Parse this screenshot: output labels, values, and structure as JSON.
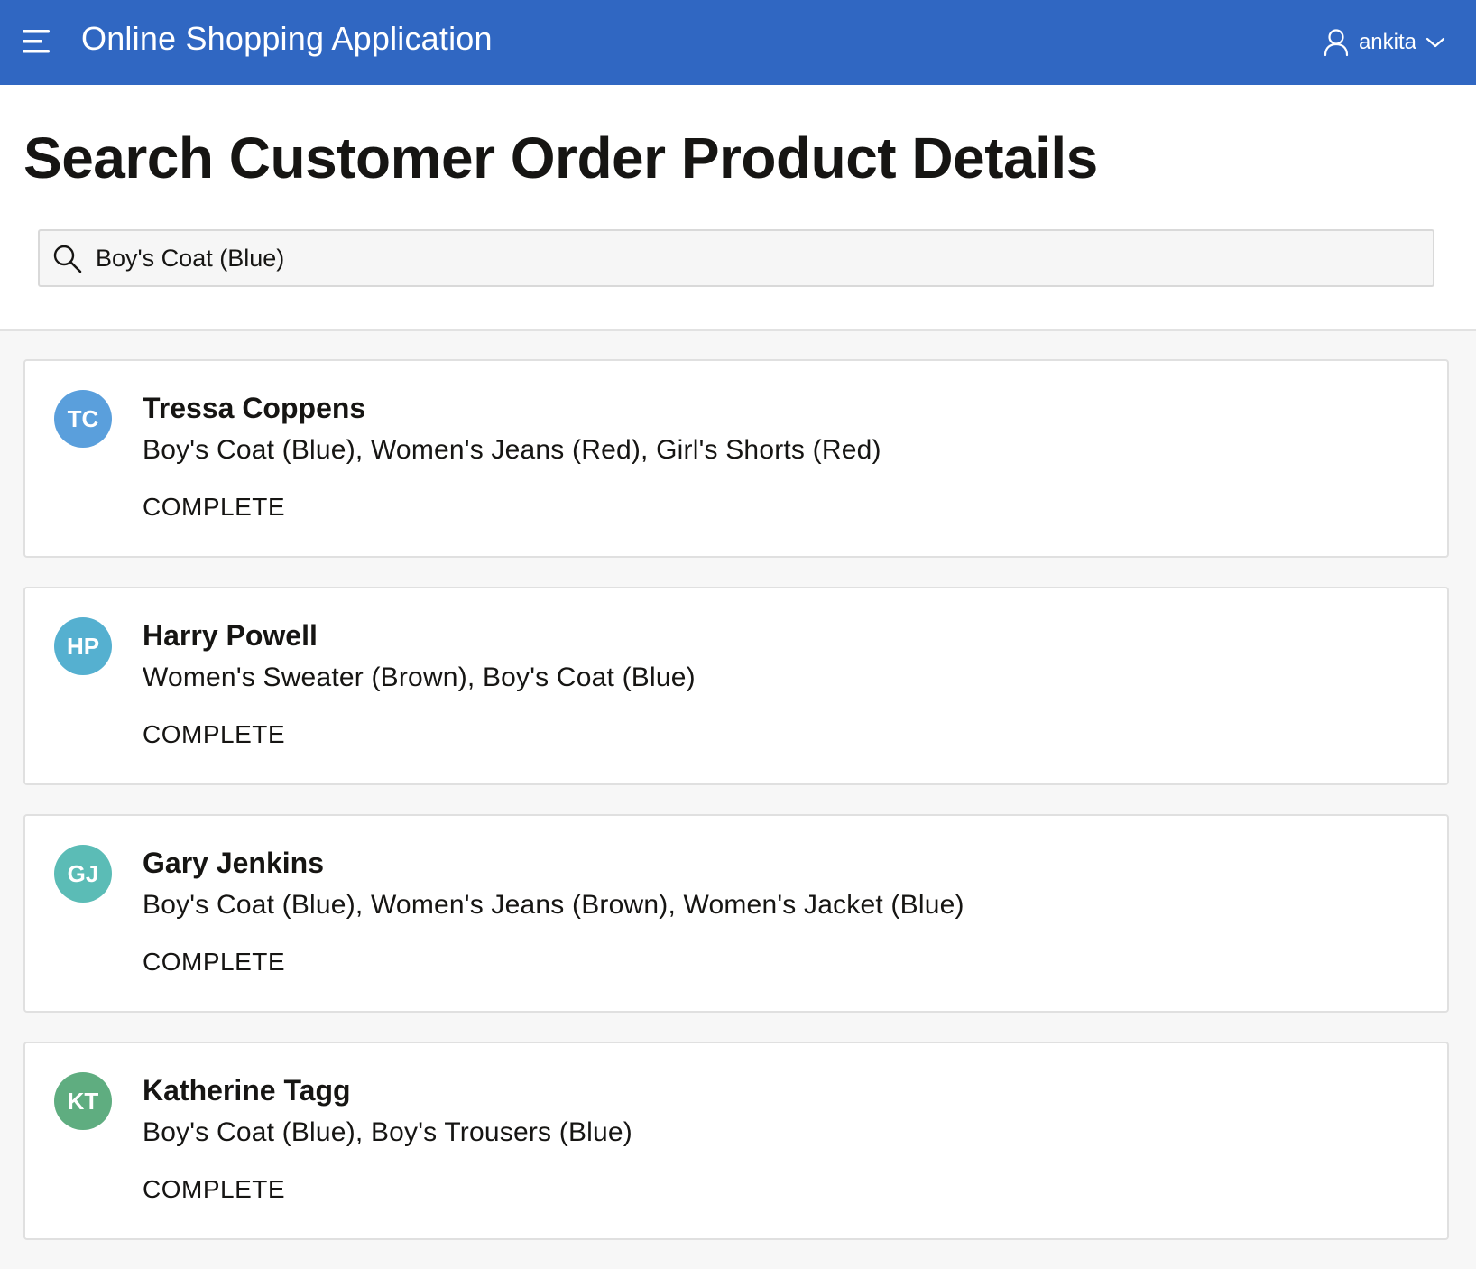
{
  "app": {
    "title": "Online Shopping Application",
    "user": "ankita",
    "accent_color": "#3067c2"
  },
  "page": {
    "title": "Search Customer Order Product Details"
  },
  "search": {
    "value": "Boy's Coat (Blue)",
    "placeholder": ""
  },
  "results": [
    {
      "initials": "TC",
      "avatar_color": "#5a9fdc",
      "name": "Tressa Coppens",
      "products": "Boy's Coat (Blue), Women's Jeans (Red), Girl's Shorts (Red)",
      "status": "COMPLETE"
    },
    {
      "initials": "HP",
      "avatar_color": "#55b0d0",
      "name": "Harry Powell",
      "products": "Women's Sweater (Brown), Boy's Coat (Blue)",
      "status": "COMPLETE"
    },
    {
      "initials": "GJ",
      "avatar_color": "#5bbcb6",
      "name": "Gary Jenkins",
      "products": "Boy's Coat (Blue), Women's Jeans (Brown), Women's Jacket (Blue)",
      "status": "COMPLETE"
    },
    {
      "initials": "KT",
      "avatar_color": "#5fad80",
      "name": "Katherine Tagg",
      "products": "Boy's Coat (Blue), Boy's Trousers (Blue)",
      "status": "COMPLETE"
    }
  ]
}
